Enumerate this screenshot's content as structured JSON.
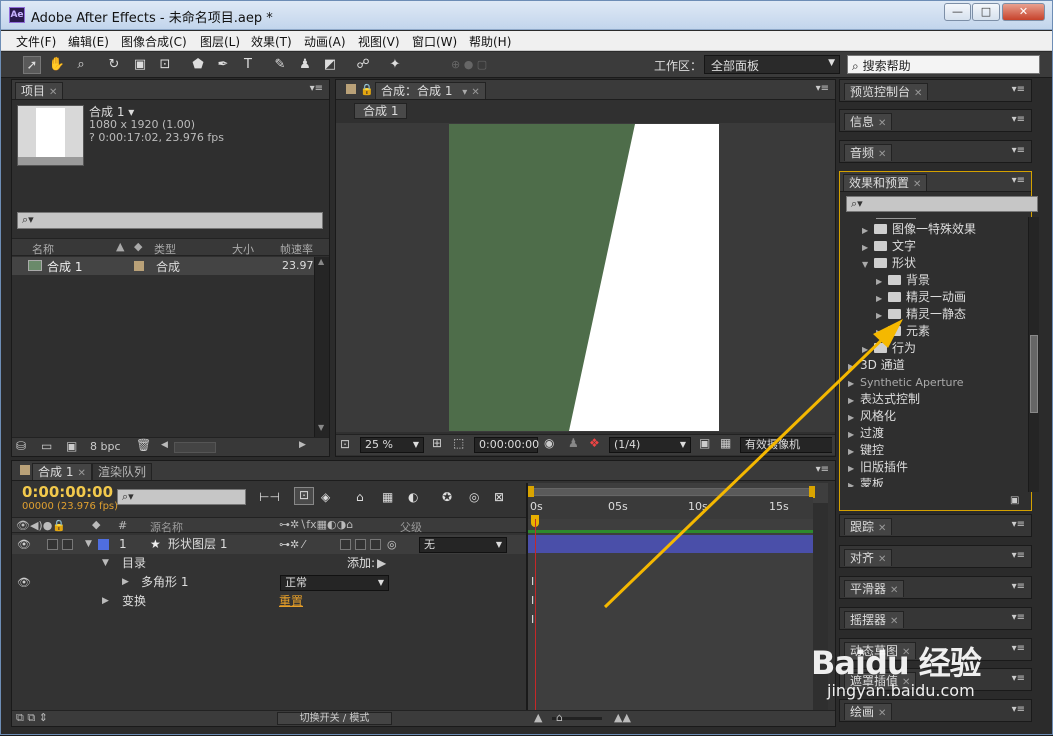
{
  "window": {
    "title": "Adobe After Effects - 未命名项目.aep *",
    "logo": "Ae"
  },
  "menu": [
    "文件(F)",
    "编辑(E)",
    "图像合成(C)",
    "图层(L)",
    "效果(T)",
    "动画(A)",
    "视图(V)",
    "窗口(W)",
    "帮助(H)"
  ],
  "toolbar": {
    "workspace_label": "工作区：",
    "workspace_value": "全部面板",
    "help_search_placeholder": "搜索帮助"
  },
  "project": {
    "tab": "项目",
    "item_name": "合成 1",
    "item_dims": "1080 x 1920 (1.00)",
    "item_duration": "? 0:00:17:02, 23.976 fps",
    "columns": [
      "名称",
      "类型",
      "大小",
      "帧速率"
    ],
    "rows": [
      {
        "name": "合成 1",
        "type": "合成",
        "size": "",
        "fps": "23.976"
      }
    ],
    "bpc": "8 bpc"
  },
  "composition": {
    "tab": "合成：合成 1",
    "subtab": "合成 1",
    "zoom": "25 %",
    "timecode": "0:00:00:00",
    "resolution": "(1/4)",
    "camera": "有效摄像机"
  },
  "right_panels": {
    "preview": "预览控制台",
    "info": "信息",
    "audio": "音频",
    "effects": "效果和预置",
    "tracker": "跟踪",
    "align": "对齐",
    "smoother": "平滑器",
    "wiggler": "摇摆器",
    "motion_sketch": "动态草图",
    "mask_interp": "遮罩插值",
    "paint": "绘画"
  },
  "effects_tree": [
    {
      "label": "图像一特殊效果",
      "level": 1,
      "folder": true,
      "open": false
    },
    {
      "label": "文字",
      "level": 1,
      "folder": true,
      "open": false
    },
    {
      "label": "形状",
      "level": 1,
      "folder": true,
      "open": true
    },
    {
      "label": "背景",
      "level": 2,
      "folder": true,
      "open": false
    },
    {
      "label": "精灵一动画",
      "level": 2,
      "folder": true,
      "open": false
    },
    {
      "label": "精灵一静态",
      "level": 2,
      "folder": true,
      "open": false
    },
    {
      "label": "元素",
      "level": 2,
      "folder": true,
      "open": false
    },
    {
      "label": "行为",
      "level": 1,
      "folder": true,
      "open": false
    },
    {
      "label": "3D 通道",
      "level": 0,
      "folder": false,
      "open": false
    },
    {
      "label": "Synthetic Aperture",
      "level": 0,
      "folder": false,
      "open": false
    },
    {
      "label": "表达式控制",
      "level": 0,
      "folder": false,
      "open": false
    },
    {
      "label": "风格化",
      "level": 0,
      "folder": false,
      "open": false
    },
    {
      "label": "过渡",
      "level": 0,
      "folder": false,
      "open": false
    },
    {
      "label": "键控",
      "level": 0,
      "folder": false,
      "open": false
    },
    {
      "label": "旧版插件",
      "level": 0,
      "folder": false,
      "open": false
    },
    {
      "label": "蒙板",
      "level": 0,
      "folder": false,
      "open": false
    }
  ],
  "timeline": {
    "tab": "合成 1",
    "render_tab": "渲染队列",
    "timecode": "0:00:00:00",
    "frames": "00000 (23.976 fps)",
    "columns": [
      "源名称",
      "父级"
    ],
    "ruler": [
      "0s",
      "05s",
      "10s",
      "15s"
    ],
    "layer": {
      "number": "1",
      "name": "形状图层 1",
      "parent": "无"
    },
    "content_label": "目录",
    "add_label": "添加:",
    "polygon_label": "多角形 1",
    "blend_mode": "正常",
    "transform_label": "变换",
    "reset_label": "重置",
    "switch_mode": "切换开关 / 模式"
  },
  "watermark": {
    "logo": "Baidu 经验",
    "site": "jingyan.baidu.com"
  },
  "colors": {
    "green": "#4e6d4a",
    "layer_bar": "#4a4fa9",
    "orange": "#f5b800",
    "timecode": "#f2c94c"
  }
}
